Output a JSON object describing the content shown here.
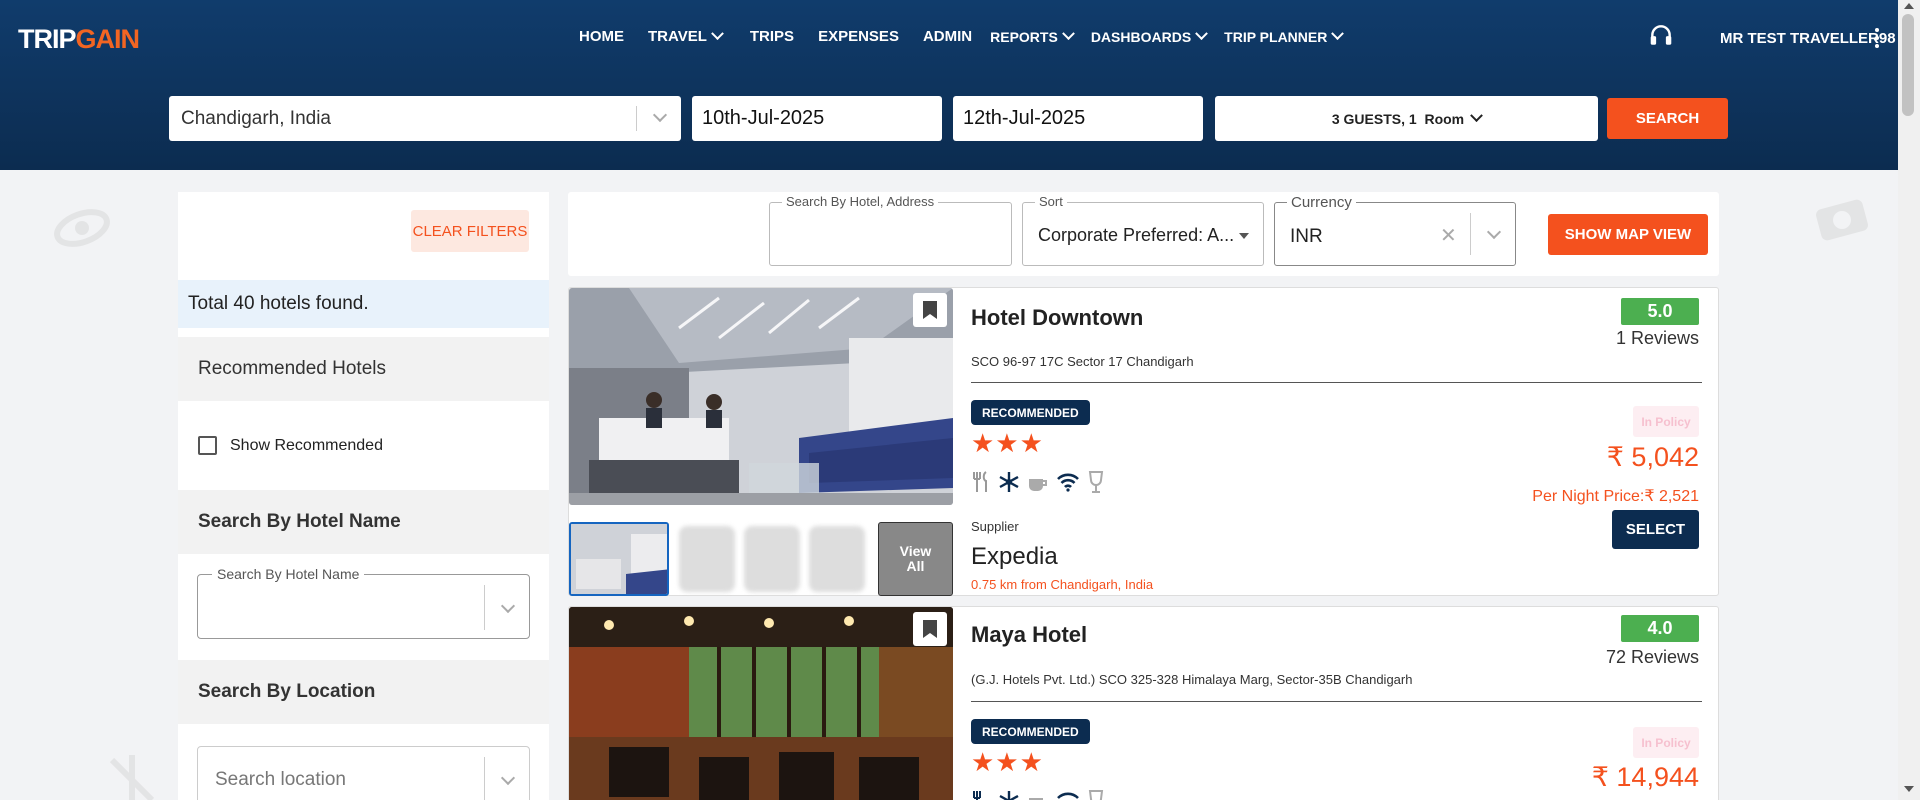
{
  "header": {
    "logo_text_1": "TRIP",
    "logo_text_2": "GAIN",
    "nav": [
      {
        "label": "HOME"
      },
      {
        "label": "TRAVEL"
      },
      {
        "label": "TRIPS"
      },
      {
        "label": "EXPENSES"
      },
      {
        "label": "ADMIN"
      },
      {
        "label": "REPORTS"
      },
      {
        "label": "DASHBOARDS"
      },
      {
        "label": "TRIP PLANNER"
      }
    ],
    "user_name": "MR TEST TRAVELLER98",
    "support_icon": "headphones-icon",
    "menu_icon": "kebab-menu-icon"
  },
  "search": {
    "city": "Chandigarh, India",
    "checkin": "10th-Jul-2025",
    "checkout": "12th-Jul-2025",
    "guests": "3 GUESTS, 1",
    "room": "Room",
    "button": "SEARCH"
  },
  "sidebar": {
    "clear_filters": "CLEAR FILTERS",
    "total": "Total 40 hotels found.",
    "recommended_heading": "Recommended Hotels",
    "show_recommended": "Show Recommended",
    "hotel_name_heading": "Search By Hotel Name",
    "hotel_name_field_label": "Search By Hotel Name",
    "location_heading": "Search By Location",
    "location_placeholder": "Search location"
  },
  "toolbar": {
    "search_label": "Search By Hotel, Address",
    "sort_label": "Sort",
    "sort_value": "Corporate Preferred: A...",
    "currency_label": "Currency",
    "currency_value": "INR",
    "map_button": "SHOW MAP VIEW"
  },
  "hotels": [
    {
      "name": "Hotel Downtown",
      "address": "SCO 96-97 17C Sector 17 Chandigarh",
      "badge": "RECOMMENDED",
      "stars": "★★★",
      "rating": "5.0",
      "reviews": "1 Reviews",
      "policy": "In Policy",
      "price": "₹ 5,042",
      "per_night": "Per Night Price:₹ 2,521",
      "select": "SELECT",
      "supplier_label": "Supplier",
      "supplier": "Expedia",
      "distance": "0.75 km from Chandigarh, India",
      "view_all": "View All"
    },
    {
      "name": "Maya Hotel",
      "address": "(G.J. Hotels Pvt. Ltd.) SCO 325-328 Himalaya Marg, Sector-35B Chandigarh",
      "badge": "RECOMMENDED",
      "stars": "★★★",
      "rating": "4.0",
      "reviews": "72 Reviews",
      "policy": "In Policy",
      "price": "₹ 14,944"
    }
  ],
  "colors": {
    "header": "#0c2c50",
    "accent": "#f4511e",
    "rating": "#4caf50"
  }
}
